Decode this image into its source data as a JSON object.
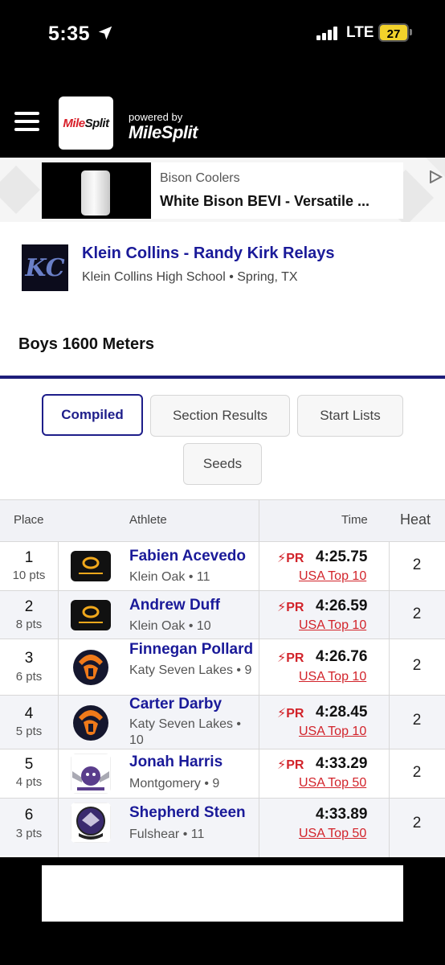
{
  "status": {
    "time": "5:35",
    "network": "LTE",
    "battery": "27"
  },
  "header": {
    "logo_text_a": "Mile",
    "logo_text_b": "Split",
    "powered_by": "powered by",
    "powered_brand": "MileSplit"
  },
  "ad": {
    "brand": "Bison Coolers",
    "title": "White Bison BEVI - Versatile ..."
  },
  "meet": {
    "logo_text": "KC",
    "title": "Klein Collins - Randy Kirk Relays",
    "subtitle": "Klein Collins High School • Spring, TX"
  },
  "event": {
    "title": "Boys 1600 Meters"
  },
  "tabs": [
    {
      "label": "Compiled",
      "active": true
    },
    {
      "label": "Section Results",
      "active": false
    },
    {
      "label": "Start Lists",
      "active": false
    },
    {
      "label": "Seeds",
      "active": false
    }
  ],
  "table": {
    "headers": {
      "place": "Place",
      "athlete": "Athlete",
      "time": "Time",
      "heat": "Heat"
    },
    "rows": [
      {
        "place": "1",
        "pts": "10 pts",
        "name": "Fabien Acevedo",
        "team": "Klein Oak • 11",
        "pr": "PR",
        "time": "4:25.75",
        "rank": "USA Top 10",
        "heat": "2",
        "logo": "klein-oak"
      },
      {
        "place": "2",
        "pts": "8 pts",
        "name": "Andrew Duff",
        "team": "Klein Oak • 10",
        "pr": "PR",
        "time": "4:26.59",
        "rank": "USA Top 10",
        "heat": "2",
        "logo": "klein-oak"
      },
      {
        "place": "3",
        "pts": "6 pts",
        "name": "Finnegan Pollard",
        "team": "Katy Seven Lakes • 9",
        "pr": "PR",
        "time": "4:26.76",
        "rank": "USA Top 10",
        "heat": "2",
        "logo": "seven-lakes"
      },
      {
        "place": "4",
        "pts": "5 pts",
        "name": "Carter Darby",
        "team": "Katy Seven Lakes • 10",
        "pr": "PR",
        "time": "4:28.45",
        "rank": "USA Top 10",
        "heat": "2",
        "logo": "seven-lakes"
      },
      {
        "place": "5",
        "pts": "4 pts",
        "name": "Jonah Harris",
        "team": "Montgomery • 9",
        "pr": "PR",
        "time": "4:33.29",
        "rank": "USA Top 50",
        "heat": "2",
        "logo": "montgomery"
      },
      {
        "place": "6",
        "pts": "3 pts",
        "name": "Shepherd Steen",
        "team": "Fulshear • 11",
        "pr": "",
        "time": "4:33.89",
        "rank": "USA Top 50",
        "heat": "2",
        "logo": "fulshear"
      }
    ]
  },
  "colors": {
    "navy": "#1e1e8a",
    "link_blue": "#1a1a99",
    "accent_red": "#d2232a",
    "battery_yellow": "#f2d22b"
  }
}
